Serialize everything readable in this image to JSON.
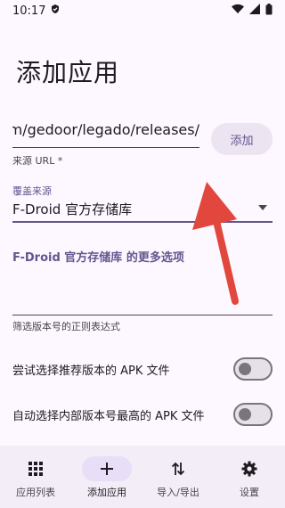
{
  "status_bar": {
    "time": "10:17",
    "left_icon": "shield-check-icon",
    "right_icons": [
      "wifi-icon",
      "signal-icon",
      "battery-icon"
    ]
  },
  "page": {
    "title": "添加应用"
  },
  "repo_url": {
    "value": "https://github.com/gedoor/legado/releases/",
    "support_text": "来源 URL *"
  },
  "add_button": {
    "label": "添加"
  },
  "source": {
    "label": "覆盖来源",
    "value": "F-Droid 官方存储库",
    "icon": "dropdown-arrow-icon"
  },
  "more_options": {
    "label": "F-Droid 官方存储库 的更多选项"
  },
  "regex_filter": {
    "value": "",
    "support_text": "筛选版本号的正则表达式"
  },
  "toggles": [
    {
      "label": "尝试选择推荐版本的 APK 文件",
      "on": false
    },
    {
      "label": "自动选择内部版本号最高的 APK 文件",
      "on": false
    }
  ],
  "nav": {
    "items": [
      {
        "label": "应用列表",
        "icon": "grid-icon",
        "active": false
      },
      {
        "label": "添加应用",
        "icon": "plus-icon",
        "active": true
      },
      {
        "label": "导入/导出",
        "icon": "import-export-icon",
        "active": false
      },
      {
        "label": "设置",
        "icon": "gear-icon",
        "active": false
      }
    ]
  },
  "colors": {
    "background": "#fdf7ff",
    "accent": "#65558f",
    "nav_background": "#f3edf7",
    "annotation_arrow": "#e2473d"
  }
}
